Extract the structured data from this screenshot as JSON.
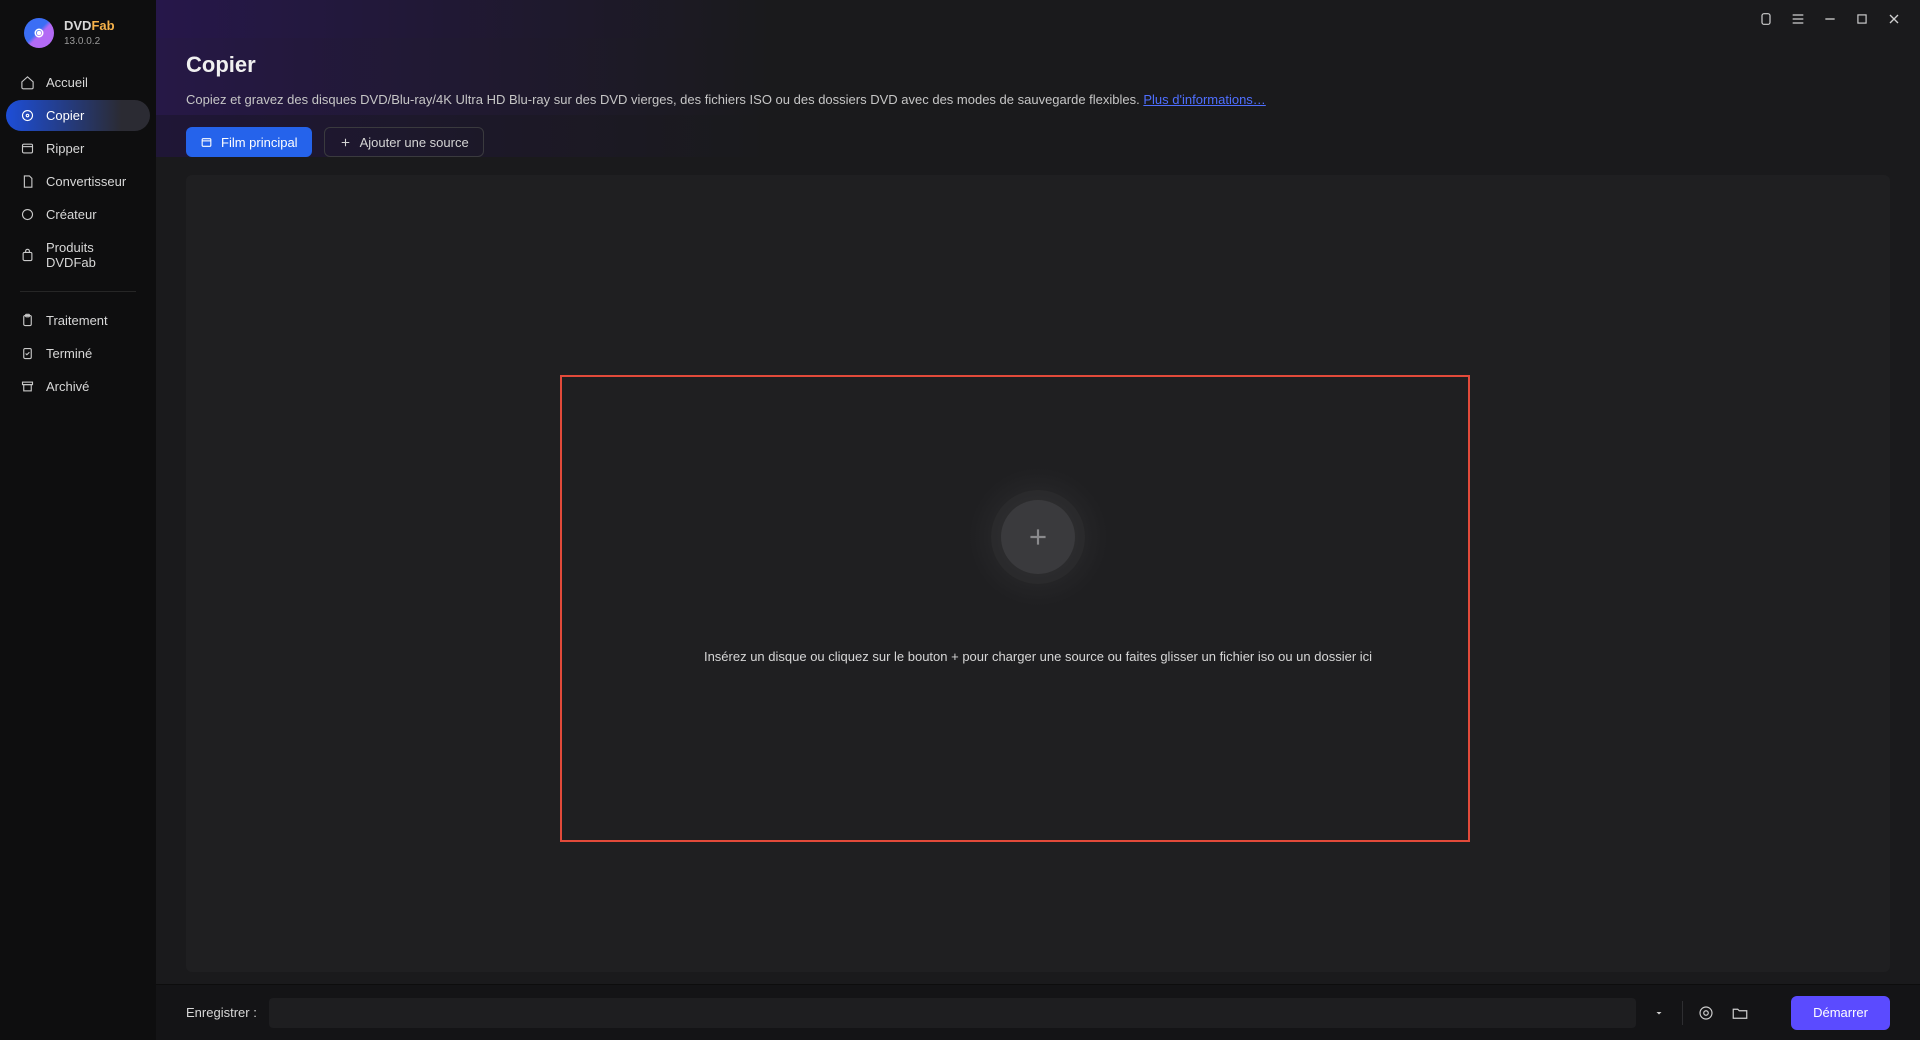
{
  "app": {
    "brand": "DVD",
    "brand_accent": "Fab",
    "version": "13.0.0.2"
  },
  "sidebar": {
    "main": [
      {
        "label": "Accueil",
        "icon": "home"
      },
      {
        "label": "Copier",
        "icon": "disc",
        "active": true
      },
      {
        "label": "Ripper",
        "icon": "box"
      },
      {
        "label": "Convertisseur",
        "icon": "file"
      },
      {
        "label": "Créateur",
        "icon": "sparkle"
      },
      {
        "label": "Produits DVDFab",
        "icon": "bag"
      }
    ],
    "secondary": [
      {
        "label": "Traitement",
        "icon": "clipboard"
      },
      {
        "label": "Terminé",
        "icon": "check"
      },
      {
        "label": "Archivé",
        "icon": "archive"
      }
    ]
  },
  "header": {
    "title": "Copier",
    "description": "Copiez et gravez des disques DVD/Blu-ray/4K Ultra HD Blu-ray sur des DVD vierges, des fichiers ISO ou des dossiers DVD avec des modes de sauvegarde flexibles. ",
    "more_link": "Plus d'informations…"
  },
  "toolbar": {
    "main_movie": "Film principal",
    "add_source": "Ajouter une source"
  },
  "drop": {
    "hint": "Insérez un disque ou cliquez sur le bouton +  pour charger une source ou faites glisser un fichier iso ou un dossier ici"
  },
  "footer": {
    "save_label": "Enregistrer :",
    "save_value": "",
    "start": "Démarrer"
  }
}
